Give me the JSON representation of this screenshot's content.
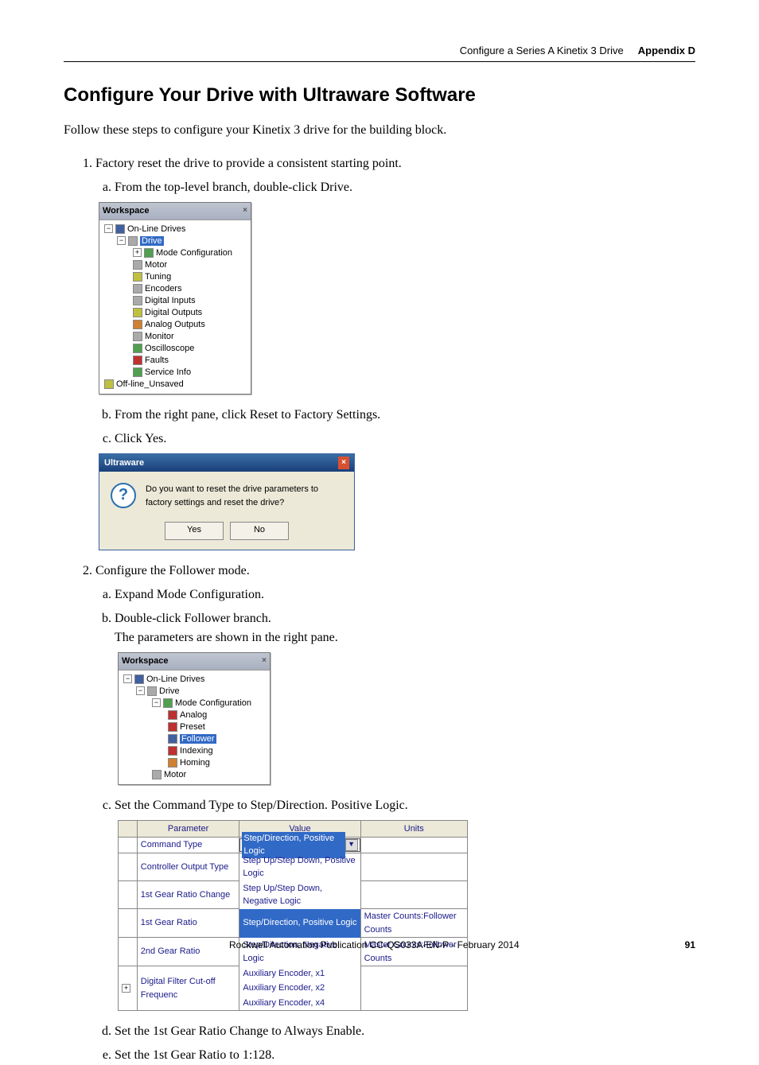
{
  "header": {
    "section": "Configure a Series A Kinetix 3 Drive",
    "appendix": "Appendix D"
  },
  "title": "Configure Your Drive with Ultraware Software",
  "intro": "Follow these steps to configure your Kinetix 3 drive for the building block.",
  "steps": {
    "s1": "Factory reset the drive to provide a consistent starting point.",
    "s1a": "From the top-level branch, double-click Drive.",
    "s1b": "From the right pane, click Reset to Factory Settings.",
    "s1c": "Click Yes.",
    "s2": "Configure the Follower mode.",
    "s2a": "Expand Mode Configuration.",
    "s2b": "Double-click Follower branch.",
    "s2b_note": "The parameters are shown in the right pane.",
    "s2c": "Set the Command Type to Step/Direction. Positive Logic.",
    "s2d": "Set the 1st Gear Ratio Change to Always Enable.",
    "s2e": "Set the 1st Gear Ratio to 1:128."
  },
  "workspace1": {
    "title": "Workspace",
    "items": {
      "online": "On-Line Drives",
      "drive": "Drive",
      "mode": "Mode Configuration",
      "motor": "Motor",
      "tuning": "Tuning",
      "encoders": "Encoders",
      "din": "Digital Inputs",
      "dout": "Digital Outputs",
      "aout": "Analog Outputs",
      "monitor": "Monitor",
      "oscope": "Oscilloscope",
      "faults": "Faults",
      "service": "Service Info",
      "offline": "Off-line_Unsaved"
    }
  },
  "dialog": {
    "title": "Ultraware",
    "msg": "Do you want to reset the drive parameters to factory settings and reset the drive?",
    "yes": "Yes",
    "no": "No"
  },
  "workspace2": {
    "title": "Workspace",
    "items": {
      "online": "On-Line Drives",
      "drive": "Drive",
      "mode": "Mode Configuration",
      "analog": "Analog",
      "preset": "Preset",
      "follower": "Follower",
      "indexing": "Indexing",
      "homing": "Homing",
      "motor": "Motor"
    }
  },
  "ptable": {
    "headers": {
      "p": "Parameter",
      "v": "Value",
      "u": "Units"
    },
    "rows": {
      "r0p": "Command Type",
      "r0v": "Step/Direction, Positive Logic",
      "r1p": "Controller Output Type",
      "r1v": "Step Up/Step Down, Positive Logic",
      "r2p": "1st Gear Ratio Change",
      "r2v": "Step Up/Step Down, Negative Logic",
      "r3p": "1st Gear Ratio",
      "r3v": "Step/Direction, Positive Logic",
      "r3u": "Master Counts:Follower Counts",
      "r4p": "2nd Gear Ratio",
      "r4v": "Step/Direction, Negative Logic",
      "r4u": "Master Counts:Follower Counts",
      "r5p": "Digital Filter Cut-off Frequenc",
      "r5v1": "Auxiliary Encoder, x1",
      "r5v2": "Auxiliary Encoder, x2",
      "r5v3": "Auxiliary Encoder, x4"
    }
  },
  "footer": {
    "pub": "Rockwell Automation Publication CC-QS033A-EN-P - February 2014",
    "page": "91"
  }
}
